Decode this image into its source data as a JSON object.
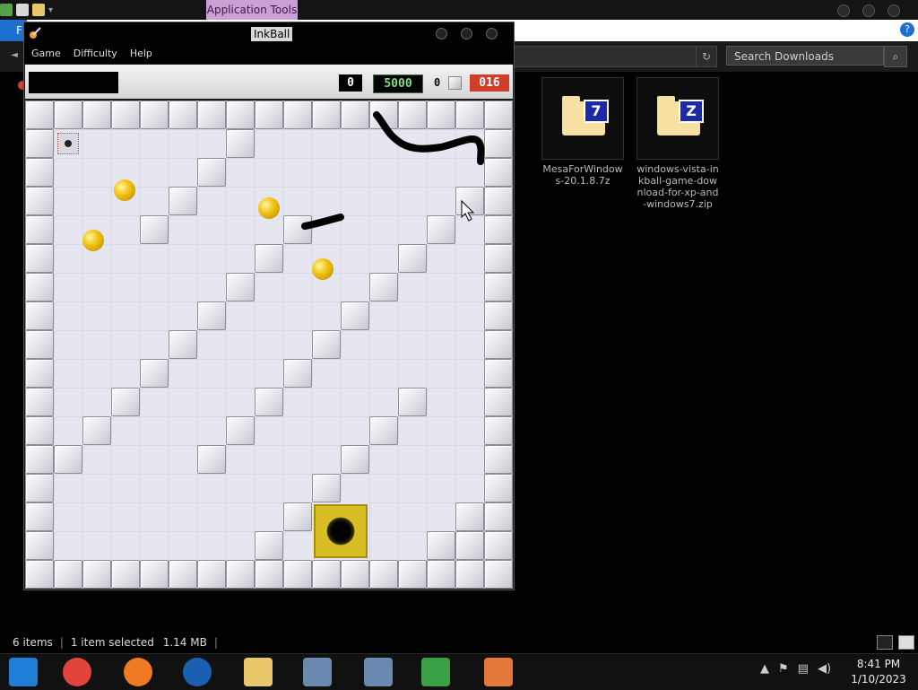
{
  "explorer": {
    "tab_label": "Application Tools",
    "file_tab": "F",
    "search_placeholder": "Search Downloads",
    "help_label": "?",
    "files": [
      {
        "name": "MesaForWindows-20.1.8.7z",
        "badge": "7"
      },
      {
        "name": "windows-vista-inkball-game-download-for-xp-and-windows7.zip",
        "badge": "Z"
      }
    ],
    "status": {
      "items_count": "6 items",
      "selected": "1 item selected",
      "size": "1.14 MB",
      "sep": "|"
    }
  },
  "inkball": {
    "title": "InkBall",
    "menu": [
      "Game",
      "Difficulty",
      "Help"
    ],
    "score_left": "0",
    "score_main": "5000",
    "balls_count": "0",
    "timer": "016",
    "colors": {
      "score_main": "#7be07b",
      "timer_bg": "#d23c2b",
      "ink": "#000000",
      "ball": "#f3c313",
      "hole": "#d7be22"
    }
  },
  "taskbar": {
    "apps": [
      "windows-explorer-icon",
      "chrome-icon",
      "firefox-icon",
      "obama-icon",
      "file-explorer-icon",
      "remote-desktop-icon",
      "remote-desktop-icon-2",
      "network-users-icon",
      "inkball-icon"
    ],
    "clock_time": "8:41 PM",
    "clock_date": "1/10/2023"
  }
}
